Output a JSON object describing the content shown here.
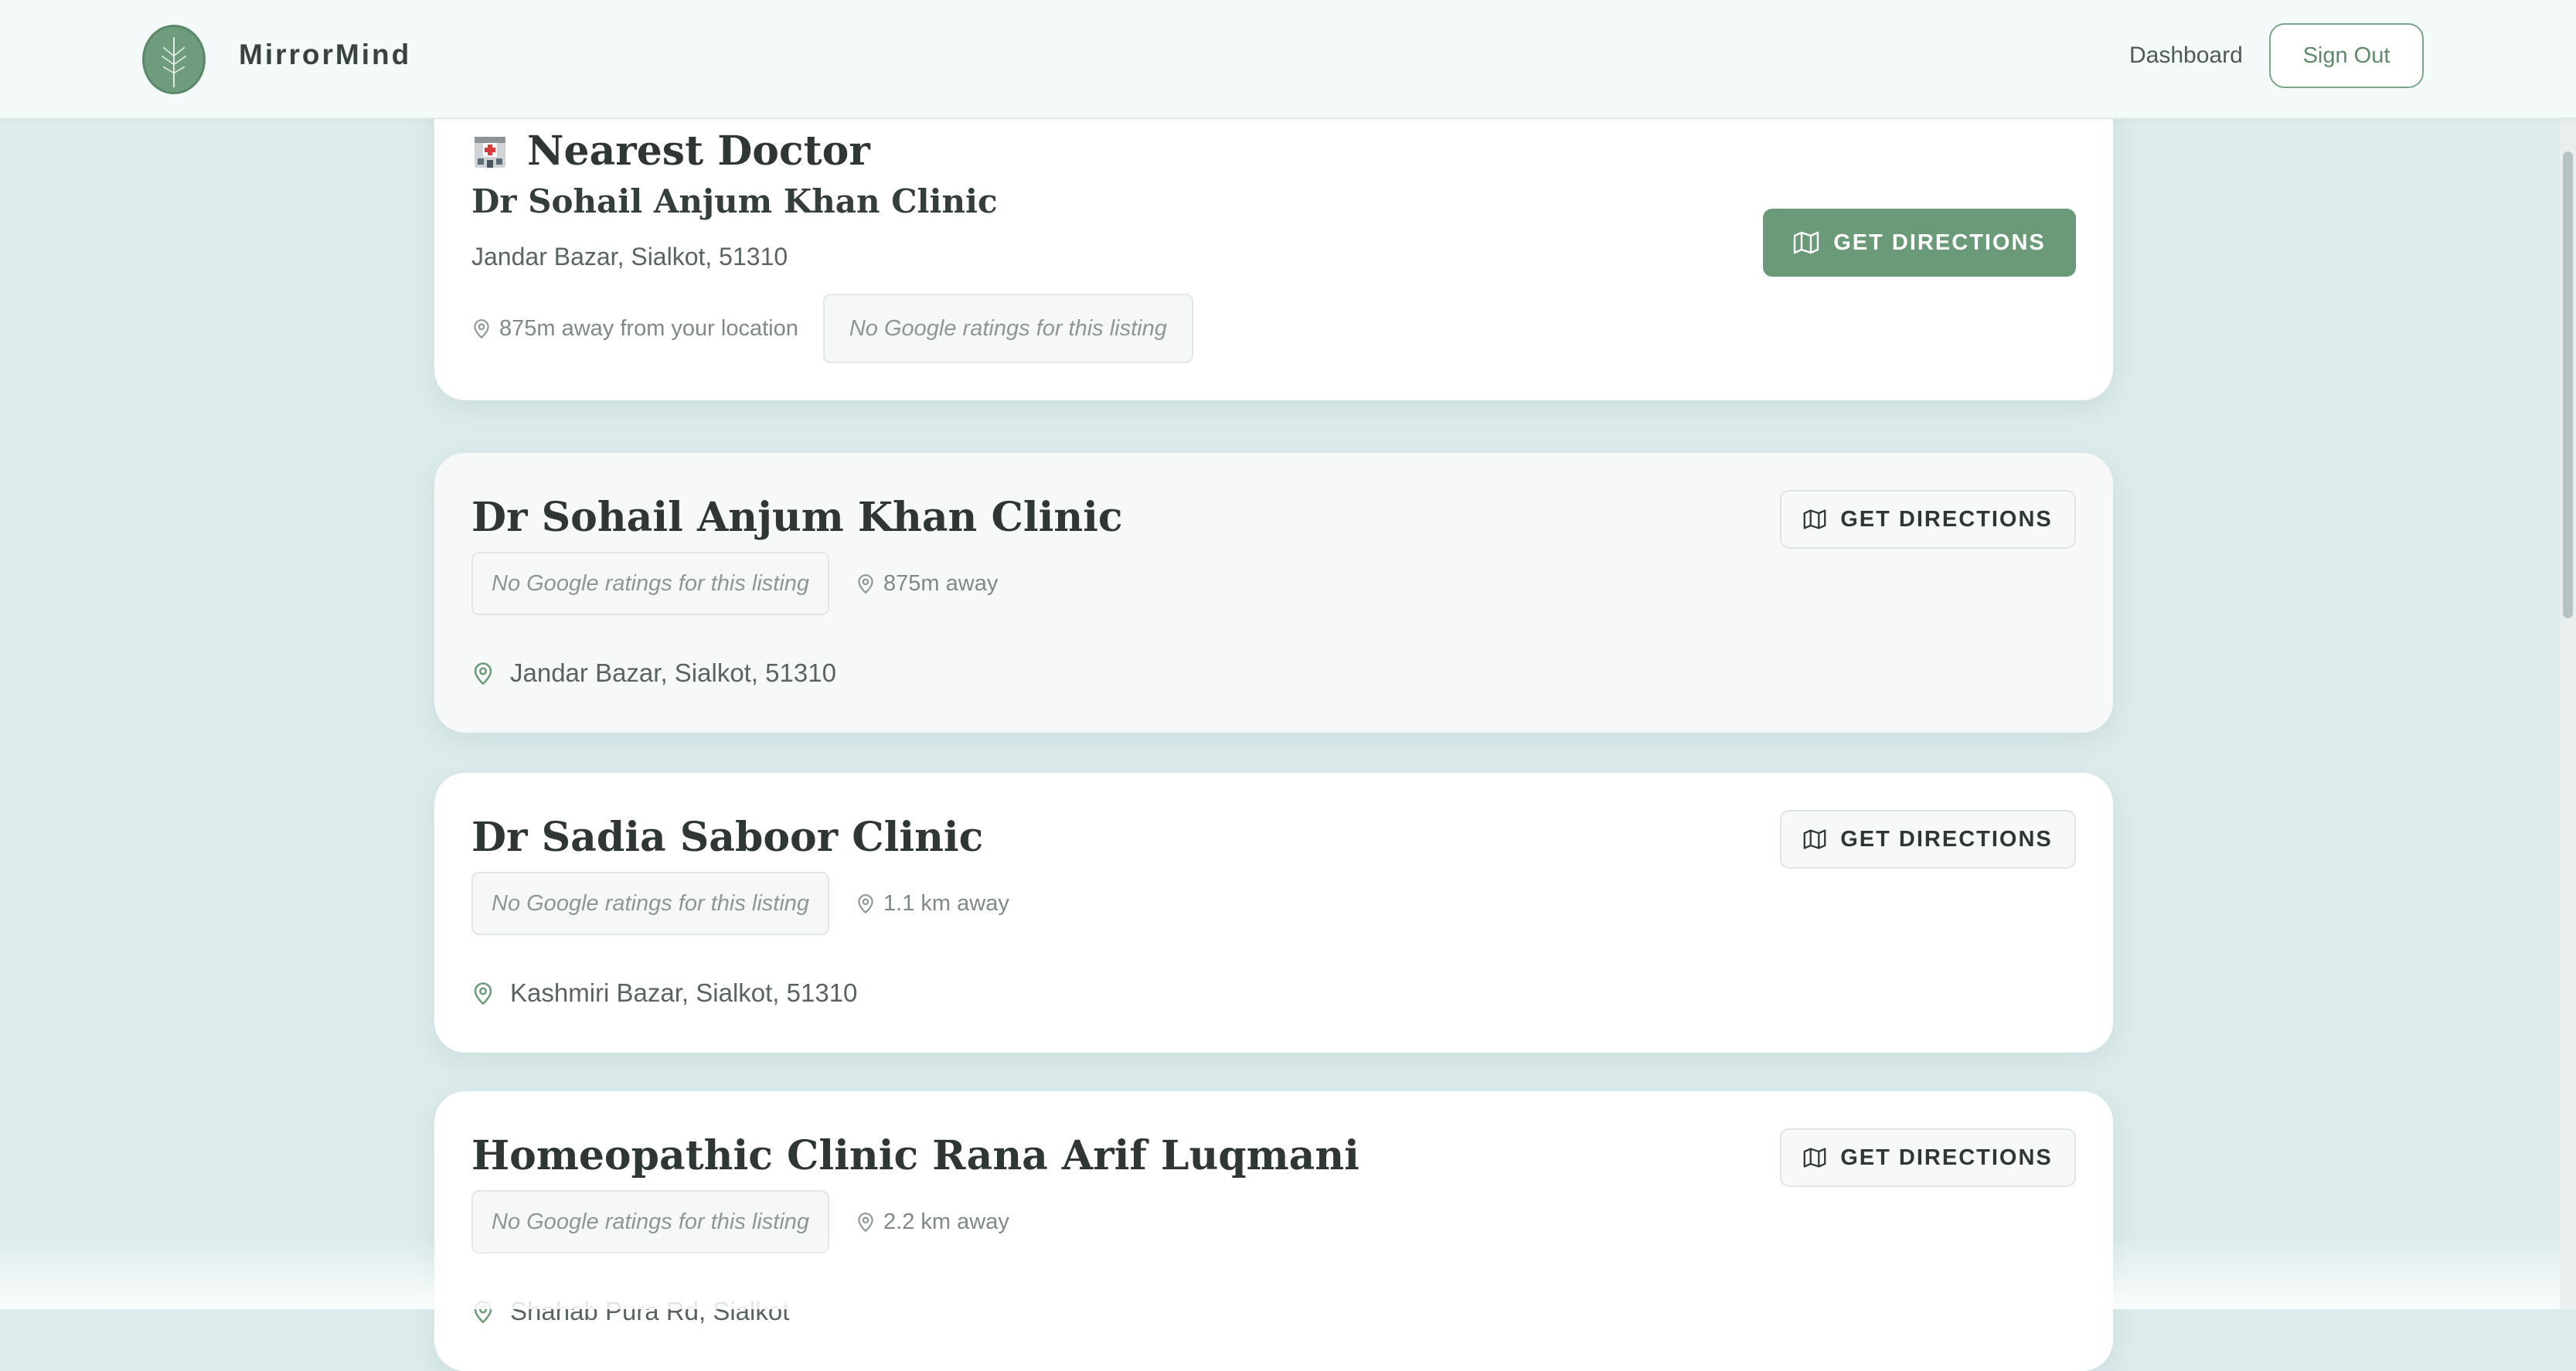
{
  "header": {
    "brand": "MirrorMind",
    "nav_dashboard": "Dashboard",
    "sign_out": "Sign Out"
  },
  "featured": {
    "icon": "hospital-icon",
    "heading": "Nearest Doctor",
    "name": "Dr Sohail Anjum Khan Clinic",
    "address": "Jandar Bazar, Sialkot, 51310",
    "distance": "875m away from your location",
    "rating": "No Google ratings for this listing",
    "button": "GET DIRECTIONS"
  },
  "clinics": [
    {
      "name": "Dr Sohail Anjum Khan Clinic",
      "rating": "No Google ratings for this listing",
      "distance": "875m away",
      "address": "Jandar Bazar, Sialkot, 51310",
      "button": "GET DIRECTIONS"
    },
    {
      "name": "Dr Sadia Saboor Clinic",
      "rating": "No Google ratings for this listing",
      "distance": "1.1 km away",
      "address": "Kashmiri Bazar, Sialkot, 51310",
      "button": "GET DIRECTIONS"
    },
    {
      "name": "Homeopathic Clinic Rana Arif Luqmani",
      "rating": "No Google ratings for this listing",
      "distance": "2.2 km away",
      "address": "Shahab Pura Rd, Sialkot",
      "button": "GET DIRECTIONS"
    }
  ],
  "colors": {
    "background": "#dcebec",
    "accent": "#6b9a78",
    "card": "#ffffff"
  }
}
